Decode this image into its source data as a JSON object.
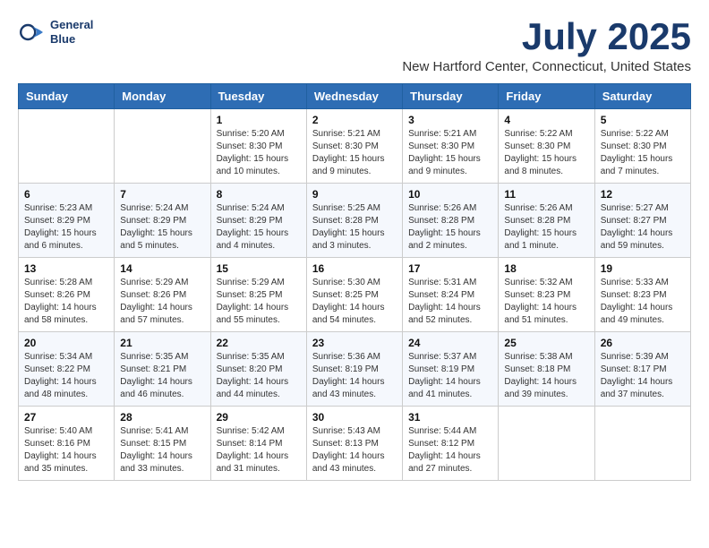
{
  "logo": {
    "line1": "General",
    "line2": "Blue"
  },
  "title": "July 2025",
  "location": "New Hartford Center, Connecticut, United States",
  "weekdays": [
    "Sunday",
    "Monday",
    "Tuesday",
    "Wednesday",
    "Thursday",
    "Friday",
    "Saturday"
  ],
  "weeks": [
    [
      {
        "day": "",
        "info": ""
      },
      {
        "day": "",
        "info": ""
      },
      {
        "day": "1",
        "info": "Sunrise: 5:20 AM\nSunset: 8:30 PM\nDaylight: 15 hours and 10 minutes."
      },
      {
        "day": "2",
        "info": "Sunrise: 5:21 AM\nSunset: 8:30 PM\nDaylight: 15 hours and 9 minutes."
      },
      {
        "day": "3",
        "info": "Sunrise: 5:21 AM\nSunset: 8:30 PM\nDaylight: 15 hours and 9 minutes."
      },
      {
        "day": "4",
        "info": "Sunrise: 5:22 AM\nSunset: 8:30 PM\nDaylight: 15 hours and 8 minutes."
      },
      {
        "day": "5",
        "info": "Sunrise: 5:22 AM\nSunset: 8:30 PM\nDaylight: 15 hours and 7 minutes."
      }
    ],
    [
      {
        "day": "6",
        "info": "Sunrise: 5:23 AM\nSunset: 8:29 PM\nDaylight: 15 hours and 6 minutes."
      },
      {
        "day": "7",
        "info": "Sunrise: 5:24 AM\nSunset: 8:29 PM\nDaylight: 15 hours and 5 minutes."
      },
      {
        "day": "8",
        "info": "Sunrise: 5:24 AM\nSunset: 8:29 PM\nDaylight: 15 hours and 4 minutes."
      },
      {
        "day": "9",
        "info": "Sunrise: 5:25 AM\nSunset: 8:28 PM\nDaylight: 15 hours and 3 minutes."
      },
      {
        "day": "10",
        "info": "Sunrise: 5:26 AM\nSunset: 8:28 PM\nDaylight: 15 hours and 2 minutes."
      },
      {
        "day": "11",
        "info": "Sunrise: 5:26 AM\nSunset: 8:28 PM\nDaylight: 15 hours and 1 minute."
      },
      {
        "day": "12",
        "info": "Sunrise: 5:27 AM\nSunset: 8:27 PM\nDaylight: 14 hours and 59 minutes."
      }
    ],
    [
      {
        "day": "13",
        "info": "Sunrise: 5:28 AM\nSunset: 8:26 PM\nDaylight: 14 hours and 58 minutes."
      },
      {
        "day": "14",
        "info": "Sunrise: 5:29 AM\nSunset: 8:26 PM\nDaylight: 14 hours and 57 minutes."
      },
      {
        "day": "15",
        "info": "Sunrise: 5:29 AM\nSunset: 8:25 PM\nDaylight: 14 hours and 55 minutes."
      },
      {
        "day": "16",
        "info": "Sunrise: 5:30 AM\nSunset: 8:25 PM\nDaylight: 14 hours and 54 minutes."
      },
      {
        "day": "17",
        "info": "Sunrise: 5:31 AM\nSunset: 8:24 PM\nDaylight: 14 hours and 52 minutes."
      },
      {
        "day": "18",
        "info": "Sunrise: 5:32 AM\nSunset: 8:23 PM\nDaylight: 14 hours and 51 minutes."
      },
      {
        "day": "19",
        "info": "Sunrise: 5:33 AM\nSunset: 8:23 PM\nDaylight: 14 hours and 49 minutes."
      }
    ],
    [
      {
        "day": "20",
        "info": "Sunrise: 5:34 AM\nSunset: 8:22 PM\nDaylight: 14 hours and 48 minutes."
      },
      {
        "day": "21",
        "info": "Sunrise: 5:35 AM\nSunset: 8:21 PM\nDaylight: 14 hours and 46 minutes."
      },
      {
        "day": "22",
        "info": "Sunrise: 5:35 AM\nSunset: 8:20 PM\nDaylight: 14 hours and 44 minutes."
      },
      {
        "day": "23",
        "info": "Sunrise: 5:36 AM\nSunset: 8:19 PM\nDaylight: 14 hours and 43 minutes."
      },
      {
        "day": "24",
        "info": "Sunrise: 5:37 AM\nSunset: 8:19 PM\nDaylight: 14 hours and 41 minutes."
      },
      {
        "day": "25",
        "info": "Sunrise: 5:38 AM\nSunset: 8:18 PM\nDaylight: 14 hours and 39 minutes."
      },
      {
        "day": "26",
        "info": "Sunrise: 5:39 AM\nSunset: 8:17 PM\nDaylight: 14 hours and 37 minutes."
      }
    ],
    [
      {
        "day": "27",
        "info": "Sunrise: 5:40 AM\nSunset: 8:16 PM\nDaylight: 14 hours and 35 minutes."
      },
      {
        "day": "28",
        "info": "Sunrise: 5:41 AM\nSunset: 8:15 PM\nDaylight: 14 hours and 33 minutes."
      },
      {
        "day": "29",
        "info": "Sunrise: 5:42 AM\nSunset: 8:14 PM\nDaylight: 14 hours and 31 minutes."
      },
      {
        "day": "30",
        "info": "Sunrise: 5:43 AM\nSunset: 8:13 PM\nDaylight: 14 hours and 43 minutes."
      },
      {
        "day": "31",
        "info": "Sunrise: 5:44 AM\nSunset: 8:12 PM\nDaylight: 14 hours and 27 minutes."
      },
      {
        "day": "",
        "info": ""
      },
      {
        "day": "",
        "info": ""
      }
    ]
  ]
}
